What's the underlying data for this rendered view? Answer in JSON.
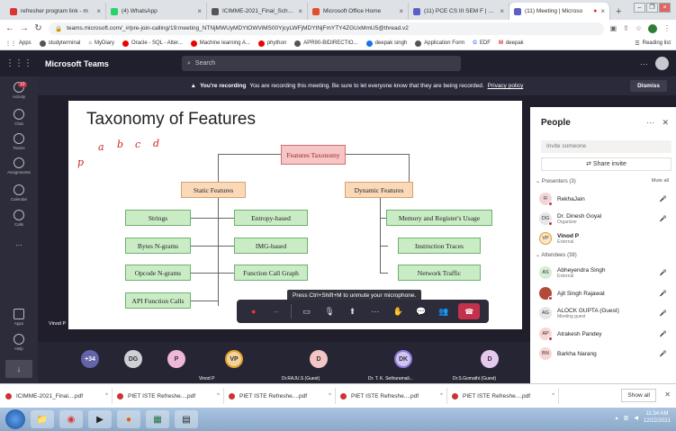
{
  "browser": {
    "tabs": [
      {
        "label": "refresher program link - m",
        "color": "#d33"
      },
      {
        "label": "(4) WhatsApp",
        "color": "#25d366"
      },
      {
        "label": "ICIMME-2021_Final_Schedu",
        "color": "#555"
      },
      {
        "label": "Microsoft Office Home",
        "color": "#e04f2a"
      },
      {
        "label": "(11) PCE CS III SEM F | Micr",
        "color": "#5b5fc7"
      },
      {
        "label": "(11) Meeting | Microso",
        "color": "#5b5fc7",
        "active": true
      }
    ],
    "url": "teams.microsoft.com/_#/pre-join-calling/19:meeting_NTNjMWUyMDYtOWViMS00YjcyLWFjMDYtNjFmYTY4ZGUxMmU5@thread.v2",
    "bookmarks": [
      "Apps",
      "studyterminal",
      "MyDiary",
      "Oracle - SQL - Alter...",
      "Machine learning A...",
      "phython",
      "APR90-BIDIRECTIO...",
      "deepak singh",
      "Application Form",
      "EDF",
      "deepak"
    ],
    "reading_list": "Reading list"
  },
  "teams": {
    "title": "Microsoft Teams",
    "search_placeholder": "Search",
    "rail": {
      "badge": "10",
      "items": [
        "Activity",
        "Chat",
        "Teams",
        "Assignments",
        "Calendar",
        "Calls",
        "...",
        "Apps",
        "Help"
      ]
    }
  },
  "recording": {
    "bold": "You're recording",
    "text": "You are recording this meeting. Be sure to let everyone know that they are being recorded.",
    "link": "Privacy policy",
    "dismiss": "Dismiss"
  },
  "slide": {
    "title": "Taxonomy of Features",
    "handwriting": [
      "a",
      "b",
      "c",
      "d",
      "p"
    ],
    "root": "Features Taxonomy",
    "static": "Static Features",
    "dynamic": "Dynamic Features",
    "static_left": [
      "Strings",
      "Bytes N-grams",
      "Opcode N-grams",
      "API Function Calls"
    ],
    "static_right": [
      "Entropy-based",
      "IMG-based",
      "Function Call Graph"
    ],
    "dynamic_items": [
      "Memory and Register's Usage",
      "Instruction Traces",
      "Network Traffic"
    ]
  },
  "presenter_label": "Vinod P",
  "toolbar_tip": "Press Ctrl+Shift+M to unmute your microphone.",
  "people": {
    "title": "People",
    "invite_placeholder": "Invite someone",
    "share_invite": "Share invite",
    "presenters_label": "Presenters (3)",
    "mute_all": "Mute all",
    "attendees_label": "Attendees (38)",
    "presenters": [
      {
        "initials": "R",
        "name": "RekhaJain",
        "sub": "",
        "color": "#f2d6d6"
      },
      {
        "initials": "DG",
        "name": "Dr. Dinesh Goyal",
        "sub": "Organizer",
        "color": "#e6e6e6"
      },
      {
        "initials": "VP",
        "name": "Vinod P",
        "sub": "External",
        "color": "#fbe6c6"
      }
    ],
    "attendees": [
      {
        "initials": "AS",
        "name": "Abheyendra Singh",
        "sub": "External",
        "color": "#d6ecd6"
      },
      {
        "initials": "",
        "name": "Ajit Singh Rajawat",
        "sub": "",
        "color": "#b04a3a"
      },
      {
        "initials": "AG",
        "name": "ALOCK GUPTA (Guest)",
        "sub": "Meeting guest",
        "color": "#e6e6e6"
      },
      {
        "initials": "AP",
        "name": "Atrakesh Pandey",
        "sub": "",
        "color": "#f6d6d6"
      },
      {
        "initials": "BN",
        "name": "Barkha Narang",
        "sub": "",
        "color": "#f6d6d6"
      }
    ]
  },
  "strip": {
    "more_count": "+34",
    "tiles": [
      {
        "initials": "DG",
        "name": "",
        "color": "#cfcfd6"
      },
      {
        "initials": "P",
        "name": "",
        "color": "#f0b8d8"
      },
      {
        "initials": "VP",
        "name": "Vinod P",
        "color": "#f3d39a"
      },
      {
        "initials": "D",
        "name": "Dr.RAJU.S (Guest)",
        "color": "#f3c5c5"
      },
      {
        "initials": "DK",
        "name": "Dr. T. K. Sethuramali...",
        "color": "#cfc5f0"
      },
      {
        "initials": "D",
        "name": "Dr.S.Gomathi (Guest)",
        "color": "#e6c8ef"
      }
    ]
  },
  "downloads": {
    "items": [
      "ICIMME-2021_Final....pdf",
      "PIET ISTE Refreshe....pdf",
      "PIET ISTE Refreshe....pdf",
      "PIET ISTE Refreshe....pdf",
      "PIET ISTE Refreshe....pdf"
    ],
    "show_all": "Show all"
  },
  "taskbar": {
    "time": "11:34 AM",
    "date": "12/22/2021"
  }
}
